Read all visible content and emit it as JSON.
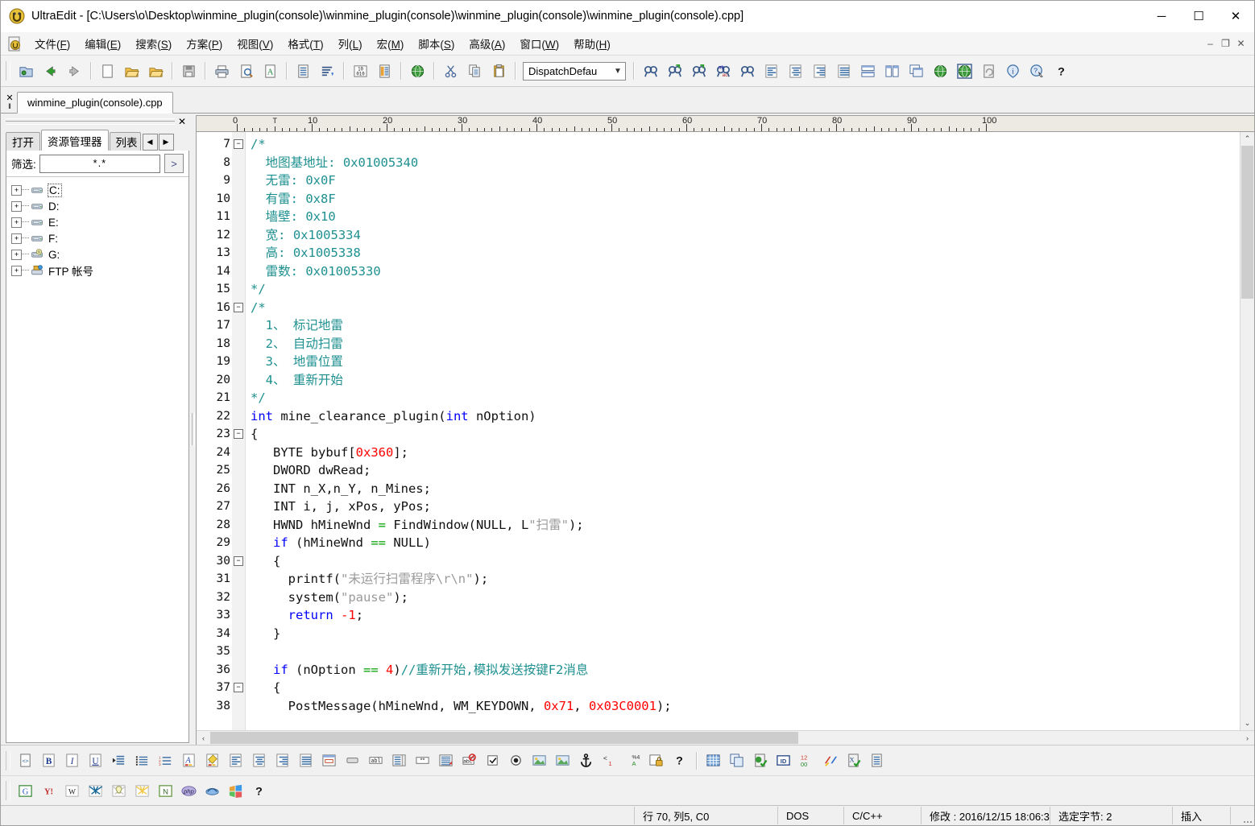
{
  "window": {
    "title": "UltraEdit - [C:\\Users\\o\\Desktop\\winmine_plugin(console)\\winmine_plugin(console)\\winmine_plugin(console)\\winmine_plugin(console).cpp]",
    "minimize": "─",
    "maximize": "☐",
    "close": "✕"
  },
  "menubar": {
    "items": [
      {
        "label": "文件(F)",
        "acc": "F"
      },
      {
        "label": "编辑(E)",
        "acc": "E"
      },
      {
        "label": "搜索(S)",
        "acc": "S"
      },
      {
        "label": "方案(P)",
        "acc": "P"
      },
      {
        "label": "视图(V)",
        "acc": "V"
      },
      {
        "label": "格式(T)",
        "acc": "T"
      },
      {
        "label": "列(L)",
        "acc": "L"
      },
      {
        "label": "宏(M)",
        "acc": "M"
      },
      {
        "label": "脚本(S)",
        "acc": "S"
      },
      {
        "label": "高级(A)",
        "acc": "A"
      },
      {
        "label": "窗口(W)",
        "acc": "W"
      },
      {
        "label": "帮助(H)",
        "acc": "H"
      }
    ],
    "mdi_minimize": "–",
    "mdi_restore": "❐",
    "mdi_close": "✕"
  },
  "toolbar": {
    "combo_value": "DispatchDefau",
    "combo_caret": "▼",
    "buttons": [
      {
        "name": "project-open-icon",
        "title": "项目"
      },
      {
        "name": "back-arrow-icon",
        "title": "后退"
      },
      {
        "name": "forward-arrow-icon",
        "title": "前进"
      },
      {
        "name": "new-file-icon",
        "title": "新建"
      },
      {
        "name": "open-file-icon",
        "title": "打开"
      },
      {
        "name": "open-folder-icon",
        "title": "打开文件夹"
      },
      {
        "name": "save-icon",
        "title": "保存"
      },
      {
        "name": "print-icon",
        "title": "打印"
      },
      {
        "name": "print-preview-icon",
        "title": "打印预览"
      },
      {
        "name": "font-icon",
        "title": "字体"
      },
      {
        "name": "document-icon",
        "title": "文档"
      },
      {
        "name": "sort-icon",
        "title": "排序"
      },
      {
        "name": "hex-icon",
        "title": "十六进制"
      },
      {
        "name": "column-icon",
        "title": "列模式"
      },
      {
        "name": "browser-icon",
        "title": "浏览器"
      },
      {
        "name": "cut-icon",
        "title": "剪切"
      },
      {
        "name": "copy-icon",
        "title": "复制"
      },
      {
        "name": "paste-icon",
        "title": "粘贴"
      },
      {
        "name": "find-icon",
        "title": "查找"
      },
      {
        "name": "find-next-icon",
        "title": "查找下一个"
      },
      {
        "name": "find-prev-icon",
        "title": "查找上一个"
      },
      {
        "name": "replace-icon",
        "title": "替换"
      },
      {
        "name": "find-in-files-icon",
        "title": "在文件中查找"
      },
      {
        "name": "align-left-icon",
        "title": "左对齐"
      },
      {
        "name": "align-center-icon",
        "title": "居中"
      },
      {
        "name": "align-right-icon",
        "title": "右对齐"
      },
      {
        "name": "align-justify-icon",
        "title": "两端对齐"
      },
      {
        "name": "tile-horizontal-icon",
        "title": "横向平铺"
      },
      {
        "name": "tile-vertical-icon",
        "title": "纵向平铺"
      },
      {
        "name": "cascade-icon",
        "title": "层叠"
      },
      {
        "name": "web-icon",
        "title": "网页"
      },
      {
        "name": "web-preview-icon",
        "title": "网页预览"
      },
      {
        "name": "refresh-page-icon",
        "title": "刷新"
      },
      {
        "name": "info-icon",
        "title": "信息"
      },
      {
        "name": "help-cursor-icon",
        "title": "帮助光标"
      },
      {
        "name": "help-icon",
        "title": "帮助"
      }
    ]
  },
  "filetabs": {
    "close_glyph": "✕",
    "items": [
      {
        "label": "winmine_plugin(console).cpp",
        "active": true
      }
    ]
  },
  "filepanel": {
    "close_glyph": "✕",
    "tabs": [
      {
        "label": "打开",
        "active": false
      },
      {
        "label": "资源管理器",
        "active": true
      },
      {
        "label": "列表",
        "active": false
      }
    ],
    "scroll_prev": "◀",
    "scroll_next": "▶",
    "filter_label": "筛选:",
    "filter_value": "*.*",
    "go_label": ">",
    "tree": [
      {
        "label": "C:",
        "icon": "drive-icon",
        "selected": true
      },
      {
        "label": "D:",
        "icon": "drive-icon",
        "selected": false
      },
      {
        "label": "E:",
        "icon": "drive-icon",
        "selected": false
      },
      {
        "label": "F:",
        "icon": "drive-icon",
        "selected": false
      },
      {
        "label": "G:",
        "icon": "cd-drive-icon",
        "selected": false
      },
      {
        "label": "FTP 帐号",
        "icon": "ftp-icon",
        "selected": false
      }
    ],
    "expand_glyph": "+"
  },
  "editor": {
    "ruler_labels": [
      "0",
      "10",
      "20",
      "30",
      "40",
      "50",
      "60",
      "70",
      "80",
      "90"
    ],
    "tab_marker": "T",
    "fold_collapse": "−",
    "lines": [
      {
        "n": "7",
        "fold": true,
        "tokens": [
          {
            "t": "/*",
            "c": "cm"
          }
        ]
      },
      {
        "n": "8",
        "fold": false,
        "tokens": [
          {
            "t": "  地图基地址: 0x01005340",
            "c": "cm"
          }
        ]
      },
      {
        "n": "9",
        "fold": false,
        "tokens": [
          {
            "t": "  无雷: 0x0F",
            "c": "cm"
          }
        ]
      },
      {
        "n": "10",
        "fold": false,
        "tokens": [
          {
            "t": "  有雷: 0x8F",
            "c": "cm"
          }
        ]
      },
      {
        "n": "11",
        "fold": false,
        "tokens": [
          {
            "t": "  墙壁: 0x10",
            "c": "cm"
          }
        ]
      },
      {
        "n": "12",
        "fold": false,
        "tokens": [
          {
            "t": "  宽: 0x1005334",
            "c": "cm"
          }
        ]
      },
      {
        "n": "13",
        "fold": false,
        "tokens": [
          {
            "t": "  高: 0x1005338",
            "c": "cm"
          }
        ]
      },
      {
        "n": "14",
        "fold": false,
        "tokens": [
          {
            "t": "  雷数: 0x01005330",
            "c": "cm"
          }
        ]
      },
      {
        "n": "15",
        "fold": false,
        "tokens": [
          {
            "t": "*/",
            "c": "cm"
          }
        ]
      },
      {
        "n": "16",
        "fold": true,
        "tokens": [
          {
            "t": "/*",
            "c": "cm"
          }
        ]
      },
      {
        "n": "17",
        "fold": false,
        "tokens": [
          {
            "t": "  1、 标记地雷",
            "c": "cm"
          }
        ]
      },
      {
        "n": "18",
        "fold": false,
        "tokens": [
          {
            "t": "  2、 自动扫雷",
            "c": "cm"
          }
        ]
      },
      {
        "n": "19",
        "fold": false,
        "tokens": [
          {
            "t": "  3、 地雷位置",
            "c": "cm"
          }
        ]
      },
      {
        "n": "20",
        "fold": false,
        "tokens": [
          {
            "t": "  4、 重新开始",
            "c": "cm"
          }
        ]
      },
      {
        "n": "21",
        "fold": false,
        "tokens": [
          {
            "t": "*/",
            "c": "cm"
          }
        ]
      },
      {
        "n": "22",
        "fold": false,
        "tokens": [
          {
            "t": "int",
            "c": "k"
          },
          {
            "t": " mine_clearance_plugin(",
            "c": "pl"
          },
          {
            "t": "int",
            "c": "k"
          },
          {
            "t": " nOption)",
            "c": "pl"
          }
        ]
      },
      {
        "n": "23",
        "fold": true,
        "tokens": [
          {
            "t": "{",
            "c": "pl"
          }
        ]
      },
      {
        "n": "24",
        "fold": false,
        "tokens": [
          {
            "t": "   BYTE bybuf[",
            "c": "pl"
          },
          {
            "t": "0x360",
            "c": "num"
          },
          {
            "t": "];",
            "c": "pl"
          }
        ]
      },
      {
        "n": "25",
        "fold": false,
        "tokens": [
          {
            "t": "   DWORD dwRead;",
            "c": "pl"
          }
        ]
      },
      {
        "n": "26",
        "fold": false,
        "tokens": [
          {
            "t": "   INT n_X,n_Y, n_Mines;",
            "c": "pl"
          }
        ]
      },
      {
        "n": "27",
        "fold": false,
        "tokens": [
          {
            "t": "   INT i, j, xPos, yPos;",
            "c": "pl"
          }
        ]
      },
      {
        "n": "28",
        "fold": false,
        "tokens": [
          {
            "t": "   HWND hMineWnd ",
            "c": "pl"
          },
          {
            "t": "=",
            "c": "op"
          },
          {
            "t": " FindWindow(NULL, L",
            "c": "pl"
          },
          {
            "t": "\"扫雷\"",
            "c": "str"
          },
          {
            "t": ");",
            "c": "pl"
          }
        ]
      },
      {
        "n": "29",
        "fold": false,
        "tokens": [
          {
            "t": "   ",
            "c": "pl"
          },
          {
            "t": "if",
            "c": "k"
          },
          {
            "t": " (hMineWnd ",
            "c": "pl"
          },
          {
            "t": "==",
            "c": "op"
          },
          {
            "t": " NULL)",
            "c": "pl"
          }
        ]
      },
      {
        "n": "30",
        "fold": true,
        "tokens": [
          {
            "t": "   {",
            "c": "pl"
          }
        ]
      },
      {
        "n": "31",
        "fold": false,
        "tokens": [
          {
            "t": "     printf(",
            "c": "pl"
          },
          {
            "t": "\"未运行扫雷程序\\r\\n\"",
            "c": "str"
          },
          {
            "t": ");",
            "c": "pl"
          }
        ]
      },
      {
        "n": "32",
        "fold": false,
        "tokens": [
          {
            "t": "     system(",
            "c": "pl"
          },
          {
            "t": "\"pause\"",
            "c": "str"
          },
          {
            "t": ");",
            "c": "pl"
          }
        ]
      },
      {
        "n": "33",
        "fold": false,
        "tokens": [
          {
            "t": "     ",
            "c": "pl"
          },
          {
            "t": "return",
            "c": "k"
          },
          {
            "t": " ",
            "c": "pl"
          },
          {
            "t": "-1",
            "c": "num"
          },
          {
            "t": ";",
            "c": "pl"
          }
        ]
      },
      {
        "n": "34",
        "fold": false,
        "tokens": [
          {
            "t": "   }",
            "c": "pl"
          }
        ]
      },
      {
        "n": "35",
        "fold": false,
        "tokens": [
          {
            "t": "",
            "c": "pl"
          }
        ]
      },
      {
        "n": "36",
        "fold": false,
        "tokens": [
          {
            "t": "   ",
            "c": "pl"
          },
          {
            "t": "if",
            "c": "k"
          },
          {
            "t": " (nOption ",
            "c": "pl"
          },
          {
            "t": "==",
            "c": "op"
          },
          {
            "t": " ",
            "c": "pl"
          },
          {
            "t": "4",
            "c": "num"
          },
          {
            "t": ")",
            "c": "pl"
          },
          {
            "t": "//重新开始,模拟发送按键F2消息",
            "c": "cm"
          }
        ]
      },
      {
        "n": "37",
        "fold": true,
        "tokens": [
          {
            "t": "   {",
            "c": "pl"
          }
        ]
      },
      {
        "n": "38",
        "fold": false,
        "tokens": [
          {
            "t": "     PostMessage(hMineWnd, WM_KEYDOWN, ",
            "c": "pl"
          },
          {
            "t": "0x71",
            "c": "num"
          },
          {
            "t": ", ",
            "c": "pl"
          },
          {
            "t": "0x03C0001",
            "c": "num"
          },
          {
            "t": ");",
            "c": "pl"
          }
        ]
      }
    ],
    "scroll_up": "⌃",
    "scroll_down": "⌄",
    "scroll_left": "‹",
    "scroll_right": "›"
  },
  "bottom_toolbar_1": [
    {
      "name": "html-tag-icon"
    },
    {
      "name": "bold-icon",
      "glyph": "B"
    },
    {
      "name": "italic-icon",
      "glyph": "I"
    },
    {
      "name": "underline-icon",
      "glyph": "U"
    },
    {
      "name": "indent-icon"
    },
    {
      "name": "bullet-list-icon"
    },
    {
      "name": "numbered-list-icon"
    },
    {
      "name": "font-color-icon",
      "glyph": "A"
    },
    {
      "name": "highlight-icon"
    },
    {
      "name": "align-left-icon"
    },
    {
      "name": "align-center-icon"
    },
    {
      "name": "align-right-icon"
    },
    {
      "name": "align-justify-icon"
    },
    {
      "name": "form-icon"
    },
    {
      "name": "button-icon"
    },
    {
      "name": "text-field-icon",
      "glyph": "abl"
    },
    {
      "name": "list-box-icon"
    },
    {
      "name": "password-field-icon",
      "glyph": "**"
    },
    {
      "name": "textarea-icon"
    },
    {
      "name": "no-script-icon"
    },
    {
      "name": "checkbox-icon",
      "glyph": "☑"
    },
    {
      "name": "radio-button-icon",
      "glyph": "◉"
    },
    {
      "name": "image-insert-icon"
    },
    {
      "name": "picture-icon"
    },
    {
      "name": "anchor-icon",
      "glyph": "⚓"
    },
    {
      "name": "special-char-icon"
    },
    {
      "name": "charset-icon"
    },
    {
      "name": "secure-page-icon"
    },
    {
      "name": "help-icon",
      "glyph": "?"
    },
    {
      "name": "table-icon"
    },
    {
      "name": "table-copy-icon"
    },
    {
      "name": "validate-icon"
    },
    {
      "name": "id-icon",
      "glyph": "ID"
    },
    {
      "name": "numbering-icon",
      "glyph": "12"
    },
    {
      "name": "spellcheck-icon"
    },
    {
      "name": "xml-validate-icon",
      "glyph": "X"
    },
    {
      "name": "help-icon-2",
      "glyph": "?"
    }
  ],
  "bottom_toolbar_2": [
    {
      "name": "google-icon",
      "glyph": "G"
    },
    {
      "name": "yahoo-icon",
      "glyph": "Y!"
    },
    {
      "name": "wikipedia-icon",
      "glyph": "W"
    },
    {
      "name": "dictionary-icon"
    },
    {
      "name": "thesaurus-icon"
    },
    {
      "name": "reference-icon"
    },
    {
      "name": "net-icon",
      "glyph": "N"
    },
    {
      "name": "php-icon",
      "glyph": "php"
    },
    {
      "name": "perl-icon"
    },
    {
      "name": "msdn-icon"
    },
    {
      "name": "help-icon",
      "glyph": "?"
    }
  ],
  "statusbar": {
    "position": "行 70, 列5, C0",
    "line_ending": "DOS",
    "language": "C/C++",
    "modified": "修改 : 2016/12/15 18:06:3",
    "selected": "选定字节: 2",
    "insert_mode": "插入"
  },
  "colors": {
    "comment": "#1f9090",
    "keyword": "#0000ff",
    "number": "#ff0000",
    "string": "#9a9a9a",
    "operator": "#00a000",
    "accent": "#3a6ea5"
  }
}
